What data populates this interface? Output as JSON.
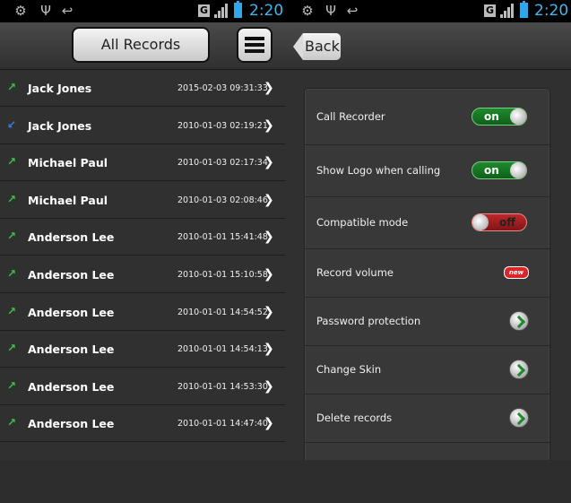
{
  "status_bar": {
    "time": "2:20",
    "network": "G",
    "icons": [
      "android-icon",
      "usb-icon",
      "missed-call-icon",
      "signal-icon",
      "battery-icon"
    ]
  },
  "left_screen": {
    "records_button": "All Records",
    "menu_icon": "list-menu-icon",
    "records": [
      {
        "direction": "outgoing",
        "name": "Jack Jones",
        "datetime": "2015-02-03 09:31:33"
      },
      {
        "direction": "incoming",
        "name": "Jack Jones",
        "datetime": "2010-01-03 02:19:21"
      },
      {
        "direction": "outgoing",
        "name": "Michael Paul",
        "datetime": "2010-01-03 02:17:34"
      },
      {
        "direction": "outgoing",
        "name": "Michael Paul",
        "datetime": "2010-01-03 02:08:46"
      },
      {
        "direction": "outgoing",
        "name": "Anderson Lee",
        "datetime": "2010-01-01 15:41:48"
      },
      {
        "direction": "outgoing",
        "name": "Anderson Lee",
        "datetime": "2010-01-01 15:10:58"
      },
      {
        "direction": "outgoing",
        "name": "Anderson Lee",
        "datetime": "2010-01-01 14:54:52"
      },
      {
        "direction": "outgoing",
        "name": "Anderson Lee",
        "datetime": "2010-01-01 14:54:13"
      },
      {
        "direction": "outgoing",
        "name": "Anderson Lee",
        "datetime": "2010-01-01 14:53:30"
      },
      {
        "direction": "outgoing",
        "name": "Anderson Lee",
        "datetime": "2010-01-01 14:47:40"
      }
    ]
  },
  "right_screen": {
    "back_button": "Back",
    "settings": [
      {
        "label": "Call Recorder",
        "control": "toggle",
        "state": "on"
      },
      {
        "label": "Show Logo when calling",
        "control": "toggle",
        "state": "on"
      },
      {
        "label": "Compatible mode",
        "control": "toggle",
        "state": "off"
      },
      {
        "label": "Record volume",
        "control": "badge",
        "badge": "new"
      },
      {
        "label": "Password protection",
        "control": "arrow"
      },
      {
        "label": "Change Skin",
        "control": "arrow"
      },
      {
        "label": "Delete records",
        "control": "arrow"
      }
    ]
  },
  "colors": {
    "background": "#303030",
    "outgoing_arrow": "#3ec04a",
    "incoming_arrow": "#3a7ee8",
    "toggle_on": "#1f8a2e",
    "toggle_off": "#c0282a",
    "clock": "#3fb7f0"
  }
}
